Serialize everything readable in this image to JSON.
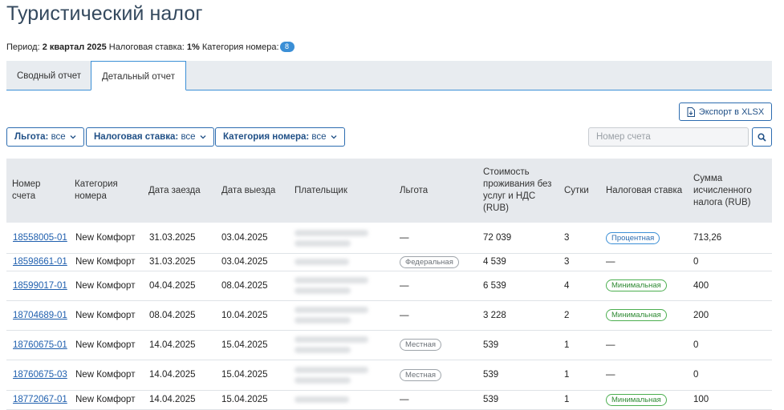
{
  "page": {
    "title": "Туристический налог"
  },
  "summary": {
    "period_label": "Период:",
    "period_value": "2 квартал 2025",
    "rate_label": "Налоговая ставка:",
    "rate_value": "1%",
    "category_label": "Категория номера:",
    "category_count": "8"
  },
  "tabs": [
    {
      "label": "Сводный отчет",
      "active": false
    },
    {
      "label": "Детальный отчет",
      "active": true
    }
  ],
  "toolbar": {
    "export_label": "Экспорт в XLSX"
  },
  "filters": [
    {
      "label": "Льгота:",
      "value": "все"
    },
    {
      "label": "Налоговая ставка:",
      "value": "все"
    },
    {
      "label": "Категория номера:",
      "value": "все"
    }
  ],
  "search": {
    "placeholder": "Номер счета"
  },
  "table": {
    "columns": [
      "Номер счета",
      "Категория номера",
      "Дата заезда",
      "Дата выезда",
      "Плательщик",
      "Льгота",
      "Стоимость проживания без услуг и НДС (RUB)",
      "Сутки",
      "Налоговая ставка",
      "Сумма исчисленного налога (RUB)"
    ],
    "rows": [
      {
        "account": "18558005-01",
        "category": "New Комфорт",
        "checkin": "31.03.2025",
        "checkout": "03.04.2025",
        "payer_lines": 2,
        "benefit": "—",
        "benefit_type": "none",
        "cost": "72 039",
        "days": "3",
        "rate": "Процентная",
        "rate_type": "blue",
        "tax": "713,26"
      },
      {
        "account": "18598661-01",
        "category": "New Комфорт",
        "checkin": "31.03.2025",
        "checkout": "03.04.2025",
        "payer_lines": 1,
        "benefit": "Федеральная",
        "benefit_type": "pill",
        "cost": "4 539",
        "days": "3",
        "rate": "—",
        "rate_type": "none",
        "tax": "0"
      },
      {
        "account": "18599017-01",
        "category": "New Комфорт",
        "checkin": "04.04.2025",
        "checkout": "08.04.2025",
        "payer_lines": 2,
        "benefit": "—",
        "benefit_type": "none",
        "cost": "6 539",
        "days": "4",
        "rate": "Минимальная",
        "rate_type": "green",
        "tax": "400"
      },
      {
        "account": "18704689-01",
        "category": "New Комфорт",
        "checkin": "08.04.2025",
        "checkout": "10.04.2025",
        "payer_lines": 2,
        "benefit": "—",
        "benefit_type": "none",
        "cost": "3 228",
        "days": "2",
        "rate": "Минимальная",
        "rate_type": "green",
        "tax": "200"
      },
      {
        "account": "18760675-01",
        "category": "New Комфорт",
        "checkin": "14.04.2025",
        "checkout": "15.04.2025",
        "payer_lines": 2,
        "benefit": "Местная",
        "benefit_type": "pill",
        "cost": "539",
        "days": "1",
        "rate": "—",
        "rate_type": "none",
        "tax": "0"
      },
      {
        "account": "18760675-03",
        "category": "New Комфорт",
        "checkin": "14.04.2025",
        "checkout": "15.04.2025",
        "payer_lines": 2,
        "benefit": "Местная",
        "benefit_type": "pill",
        "cost": "539",
        "days": "1",
        "rate": "—",
        "rate_type": "none",
        "tax": "0"
      },
      {
        "account": "18772067-01",
        "category": "New Комфорт",
        "checkin": "14.04.2025",
        "checkout": "15.04.2025",
        "payer_lines": 1,
        "benefit": "—",
        "benefit_type": "none",
        "cost": "539",
        "days": "1",
        "rate": "Минимальная",
        "rate_type": "green",
        "tax": "100"
      }
    ]
  },
  "colors": {
    "accent": "#3b8fd6",
    "link": "#1f5fae",
    "header_bg": "#e6e9ed",
    "green": "#4caf50",
    "gray": "#9ea4aa"
  },
  "icons": {
    "export": "file-download-icon",
    "dropdown": "chevron-down-icon",
    "search": "search-icon"
  }
}
